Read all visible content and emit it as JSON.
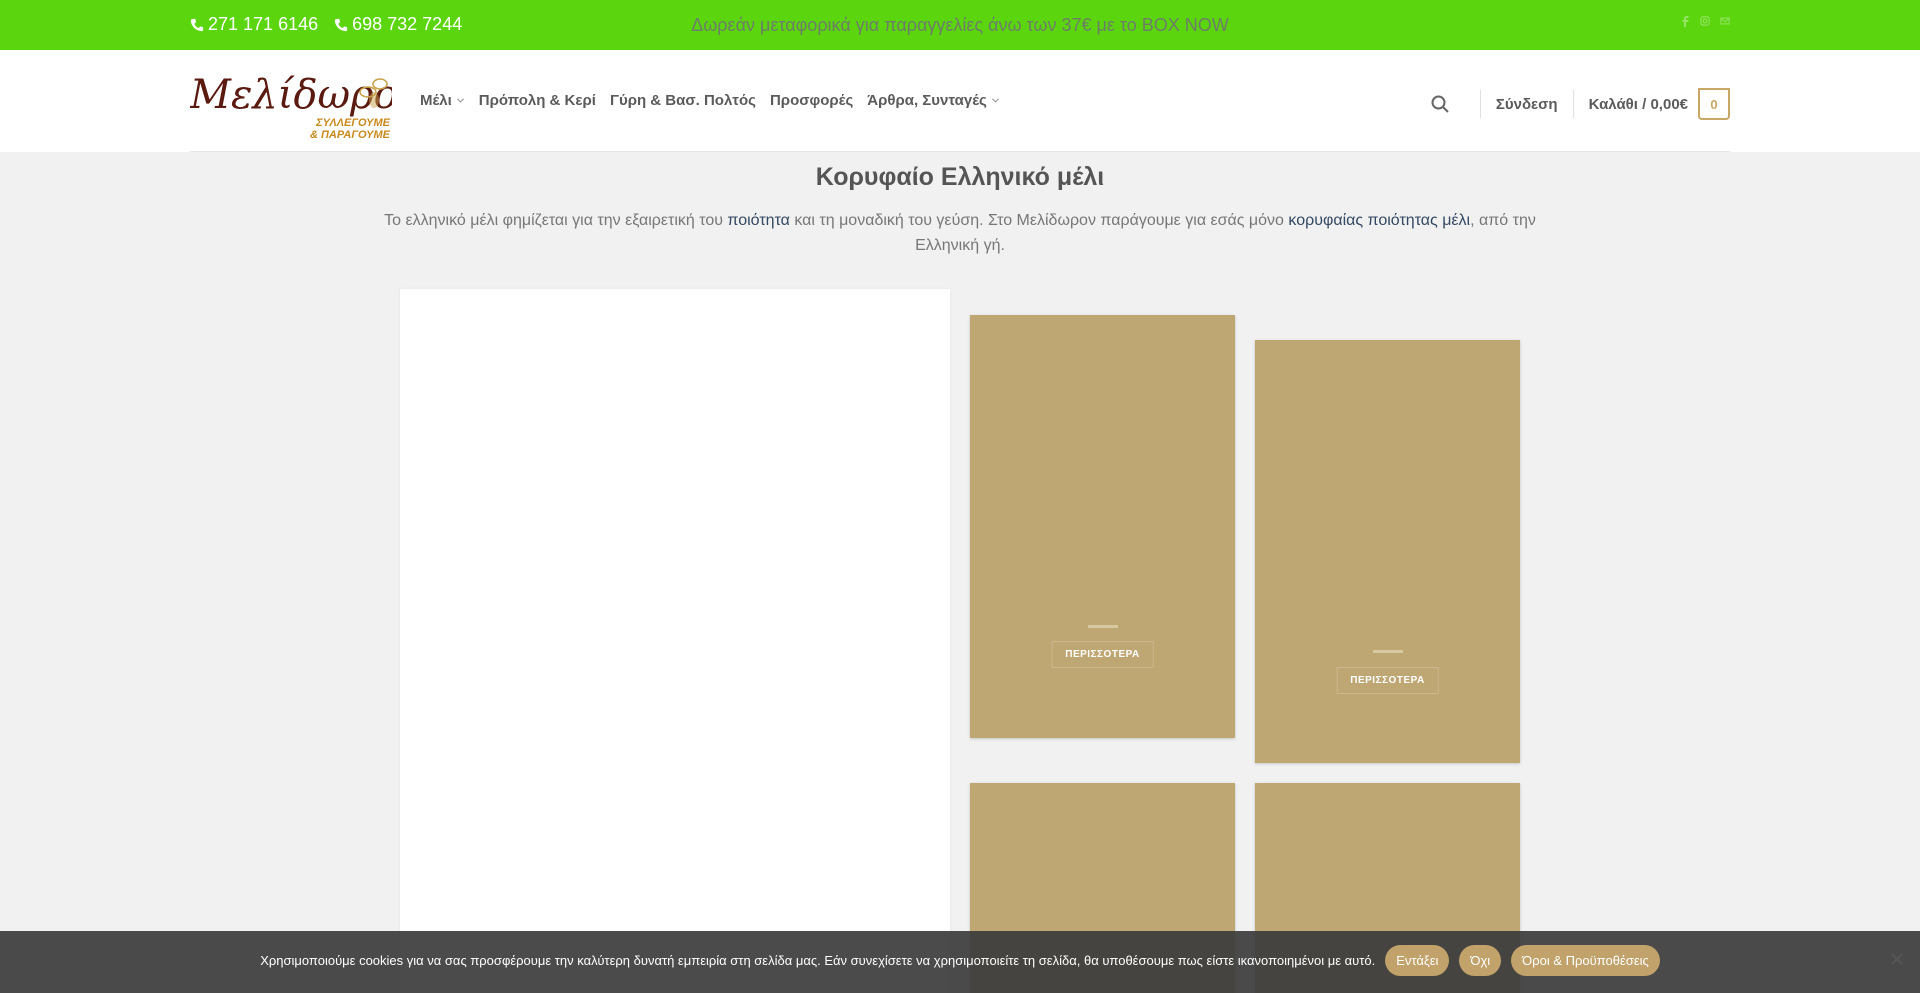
{
  "topbar": {
    "phone1": "271 171 6146",
    "phone2": "698 732 7244",
    "promo": "Δωρεάν μεταφορικά για παραγγελίες άνω των 37€ με το BOX NOW",
    "bg_color": "#5bd50e"
  },
  "header": {
    "logo_text": "Μελίδωρον",
    "logo_sub1": "ΣΥΛΛΕΓΟΥΜΕ",
    "logo_sub2": "& ΠΑΡΑΓΟΥΜΕ",
    "nav": [
      {
        "label": "Μέλι",
        "has_dropdown": true
      },
      {
        "label": "Πρόπολη & Κερί",
        "has_dropdown": false
      },
      {
        "label": "Γύρη & Βασ. Πολτός",
        "has_dropdown": false
      },
      {
        "label": "Προσφορές",
        "has_dropdown": false
      },
      {
        "label": "Άρθρα, Συνταγές",
        "has_dropdown": true
      }
    ],
    "login": "Σύνδεση",
    "cart_label": "Καλάθι / 0,00€",
    "cart_count": "0"
  },
  "main": {
    "title": "Κορυφαίο Ελληνικό μέλι",
    "intro_part1": "Το ελληνικό μέλι φημίζεται για την εξαιρετική του ",
    "intro_link1": "ποιότητα",
    "intro_part2": " και τη μοναδική του γεύση. Στο Μελίδωρον παράγουμε για εσάς μόνο ",
    "intro_link2": "κορυφαίας ποιότητας μέλι",
    "intro_part3": ", από την Ελληνική γή.",
    "cards": [
      {
        "button": "ΠΕΡΙΣΣΟΤΕΡΑ"
      },
      {
        "button": "ΠΕΡΙΣΣΟΤΕΡΑ"
      }
    ],
    "card_color": "#bfa774"
  },
  "cookie": {
    "text": "Χρησιμοποιούμε cookies για να σας προσφέρουμε την καλύτερη δυνατή εμπειρία στη σελίδα μας. Εάν συνεχίσετε να χρησιμοποιείτε τη σελίδα, θα υποθέσουμε πως είστε ικανοποιημένοι με αυτό.",
    "accept": "Εντάξει",
    "decline": "Όχι",
    "terms": "Όροι & Προϋποθέσεις"
  }
}
